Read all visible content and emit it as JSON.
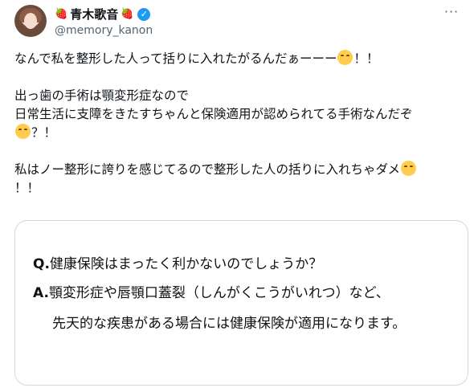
{
  "user": {
    "display_name": "青木歌音",
    "name_emoji_left": "🍓",
    "name_emoji_right": "🍓",
    "handle": "@memory_kanon",
    "verified_icon": "verified-badge-icon",
    "avatar_icon": "avatar-photo"
  },
  "more_label": "···",
  "tweet": {
    "line1": "なんで私を整形した人って括りに入れたがるんだぁーーー",
    "line1_end": "！！",
    "line2": "出っ歯の手術は顎変形症なので",
    "line3": "日常生活に支障をきたすちゃんと保険適用が認められてる手術なんだぞ",
    "line4_end": "？！",
    "line5": "私はノー整形に誇りを感じてるので整形した人の括りに入れちゃダメ",
    "line6": "！！",
    "emoji": "face-with-steam-from-nose"
  },
  "card": {
    "q_prefix": "Q.",
    "q_text": "健康保険はまったく利かないのでしょうか？",
    "a_prefix": "A.",
    "a_text": "顎変形症や唇顎口蓋裂（しんがくこうがいれつ）など、",
    "a_text2": "先天的な疾患がある場合には健康保険が適用になります。"
  },
  "colors": {
    "text": "#0f1419",
    "secondary": "#536471",
    "verified": "#1d9bf0",
    "border": "#cfd9de"
  }
}
